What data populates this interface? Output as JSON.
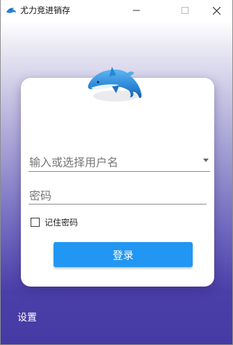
{
  "window": {
    "title": "尤力竞进销存",
    "app_icon": "dolphin-icon",
    "controls": [
      "minimize-icon",
      "maximize-icon",
      "close-icon"
    ]
  },
  "logo": {
    "icon": "dolphin-icon"
  },
  "login": {
    "username_placeholder": "输入或选择用户名",
    "password_placeholder": "密码",
    "remember_label": "记住密码",
    "remember_checked": false,
    "submit_label": "登录"
  },
  "footer": {
    "settings_label": "设置"
  },
  "colors": {
    "primary": "#2196f3",
    "background_top": "#ffffff",
    "background_bottom": "#463aa5"
  }
}
